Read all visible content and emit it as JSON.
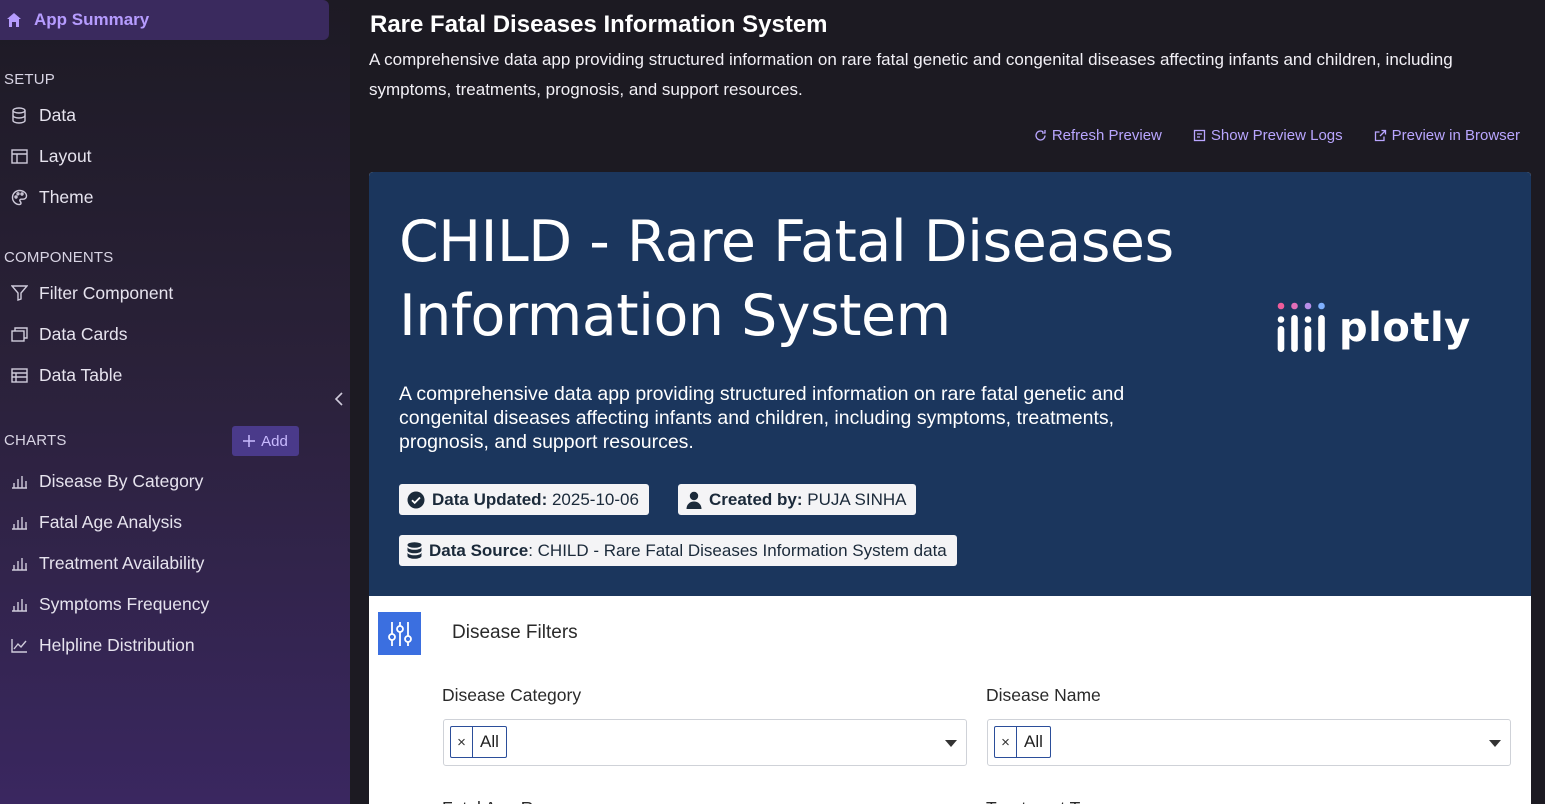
{
  "sidebar": {
    "app_summary": "App Summary",
    "setup_title": "SETUP",
    "setup_items": [
      {
        "label": "Data",
        "icon": "database-icon"
      },
      {
        "label": "Layout",
        "icon": "layout-icon"
      },
      {
        "label": "Theme",
        "icon": "palette-icon"
      }
    ],
    "components_title": "COMPONENTS",
    "component_items": [
      {
        "label": "Filter Component",
        "icon": "filter-icon"
      },
      {
        "label": "Data Cards",
        "icon": "cards-icon"
      },
      {
        "label": "Data Table",
        "icon": "table-icon"
      }
    ],
    "charts_title": "CHARTS",
    "add_label": "Add",
    "chart_items": [
      {
        "label": "Disease By Category",
        "icon": "bar-chart-icon"
      },
      {
        "label": "Fatal Age Analysis",
        "icon": "bar-chart-icon"
      },
      {
        "label": "Treatment Availability",
        "icon": "bar-chart-icon"
      },
      {
        "label": "Symptoms Frequency",
        "icon": "bar-chart-icon"
      },
      {
        "label": "Helpline Distribution",
        "icon": "line-chart-icon"
      }
    ]
  },
  "header": {
    "title": "Rare Fatal Diseases Information System",
    "description": "A comprehensive data app providing structured information on rare fatal genetic and congenital diseases affecting infants and children, including symptoms, treatments, prognosis, and support resources.",
    "links": {
      "refresh": "Refresh Preview",
      "logs": "Show Preview Logs",
      "browser": "Preview in Browser"
    }
  },
  "preview": {
    "title": "CHILD - Rare Fatal Diseases Information System",
    "description": "A comprehensive data app providing structured information on rare fatal genetic and congenital diseases affecting infants and children, including symptoms, treatments, prognosis, and support resources.",
    "logo_text": "plotly",
    "badges": {
      "updated_label": "Data Updated:",
      "updated_value": "2025-10-06",
      "created_label": "Created by:",
      "created_value": "PUJA SINHA",
      "source_label": "Data Source",
      "source_value": ": CHILD - Rare Fatal Diseases Information System data"
    },
    "filters": {
      "title": "Disease Filters",
      "category_label": "Disease Category",
      "category_value": "All",
      "name_label": "Disease Name",
      "name_value": "All",
      "chip_remove": "×",
      "fatal_age_label": "Fatal Age Range",
      "treatment_label": "Treatment Type"
    }
  },
  "colors": {
    "accent": "#b69cff",
    "banner": "#1b365d",
    "filter_icon": "#3b6fe0",
    "sidebar_active": "#3a2a5e"
  }
}
